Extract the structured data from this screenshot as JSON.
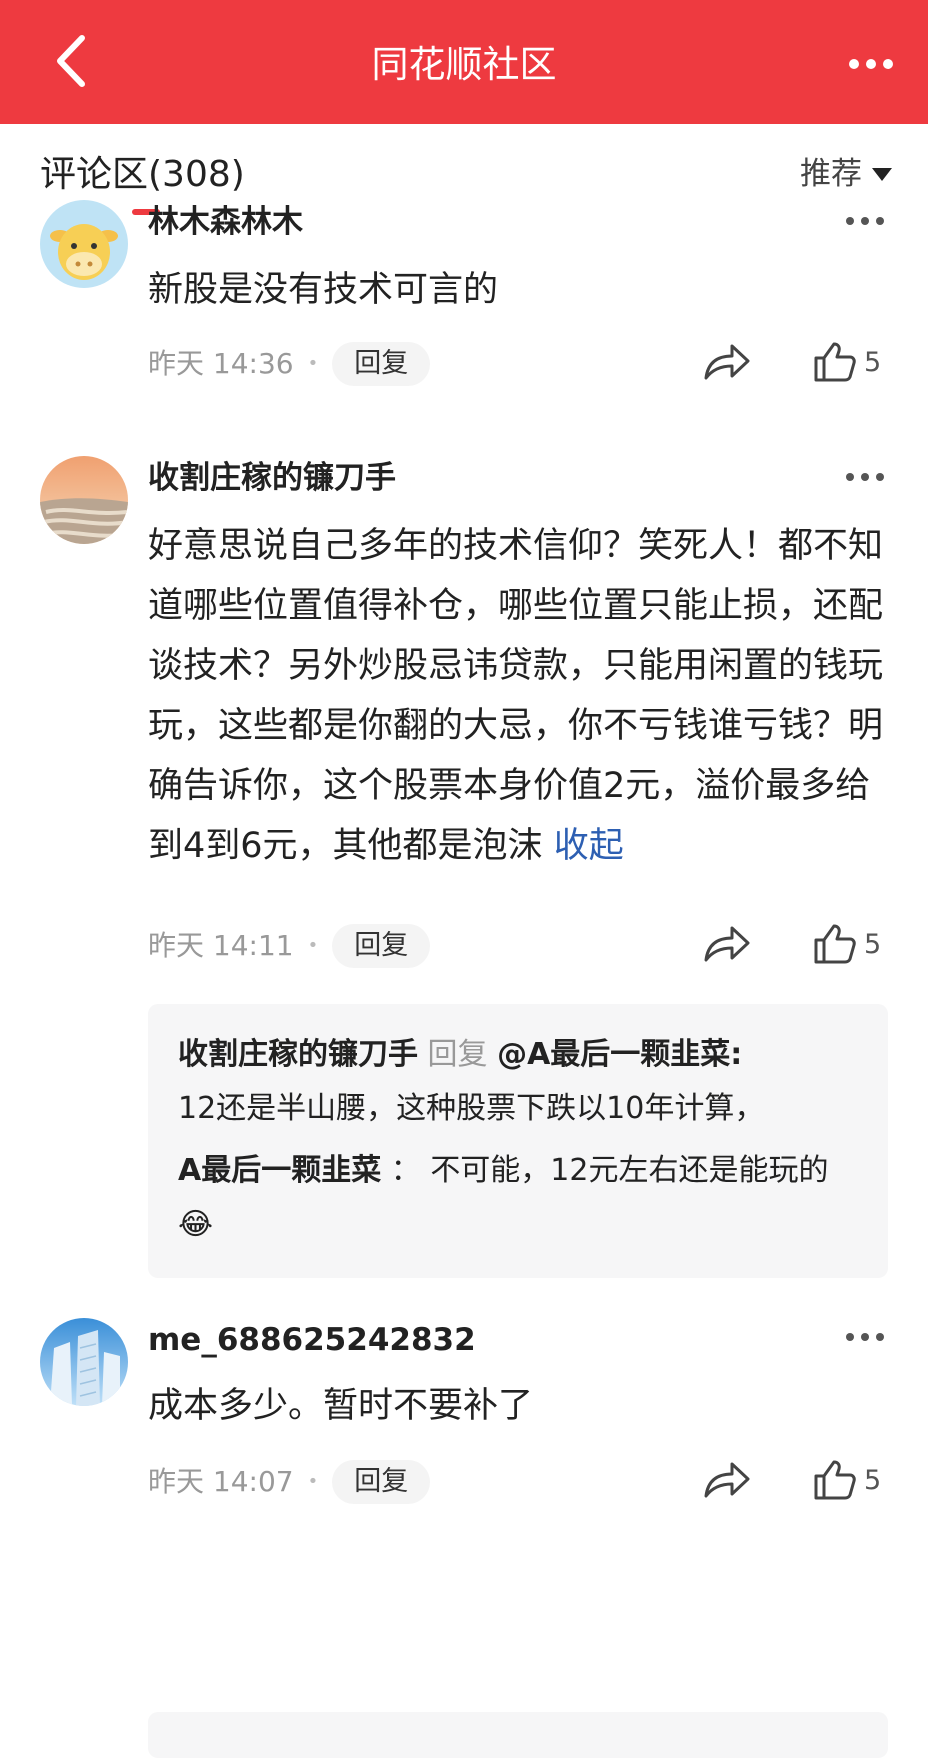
{
  "header": {
    "title": "同花顺社区"
  },
  "comments_section": {
    "title": "评论区(308)",
    "sort": "推荐"
  },
  "comments": [
    {
      "user": "林木森林木",
      "text": "新股是没有技术可言的",
      "time": "昨天 14:36",
      "reply_label": "回复",
      "likes": "5"
    },
    {
      "user": "收割庄稼的镰刀手",
      "text": "好意思说自己多年的技术信仰？笑死人！都不知道哪些位置值得补仓，哪些位置只能止损，还配谈技术？另外炒股忌讳贷款，只能用闲置的钱玩玩，这些都是你翻的大忌，你不亏钱谁亏钱？明确告诉你，这个股票本身价值2元，溢价最多给到4到6元，其他都是泡沫",
      "collapse_label": "收起",
      "time": "昨天 14:11",
      "reply_label": "回复",
      "likes": "5",
      "replies": [
        {
          "user": "收割庄稼的镰刀手",
          "reply_word": "回复",
          "target": "@A最后一颗韭菜:",
          "text": "12还是半山腰，这种股票下跌以10年计算，"
        },
        {
          "user": "A最后一颗韭菜",
          "separator": "：",
          "text": "不可能，12元左右还是能玩的",
          "emoji": "😂"
        }
      ]
    },
    {
      "user": "me_688625242832",
      "text": "成本多少。暂时不要补了",
      "time": "昨天 14:07",
      "reply_label": "回复",
      "likes": "5"
    }
  ]
}
